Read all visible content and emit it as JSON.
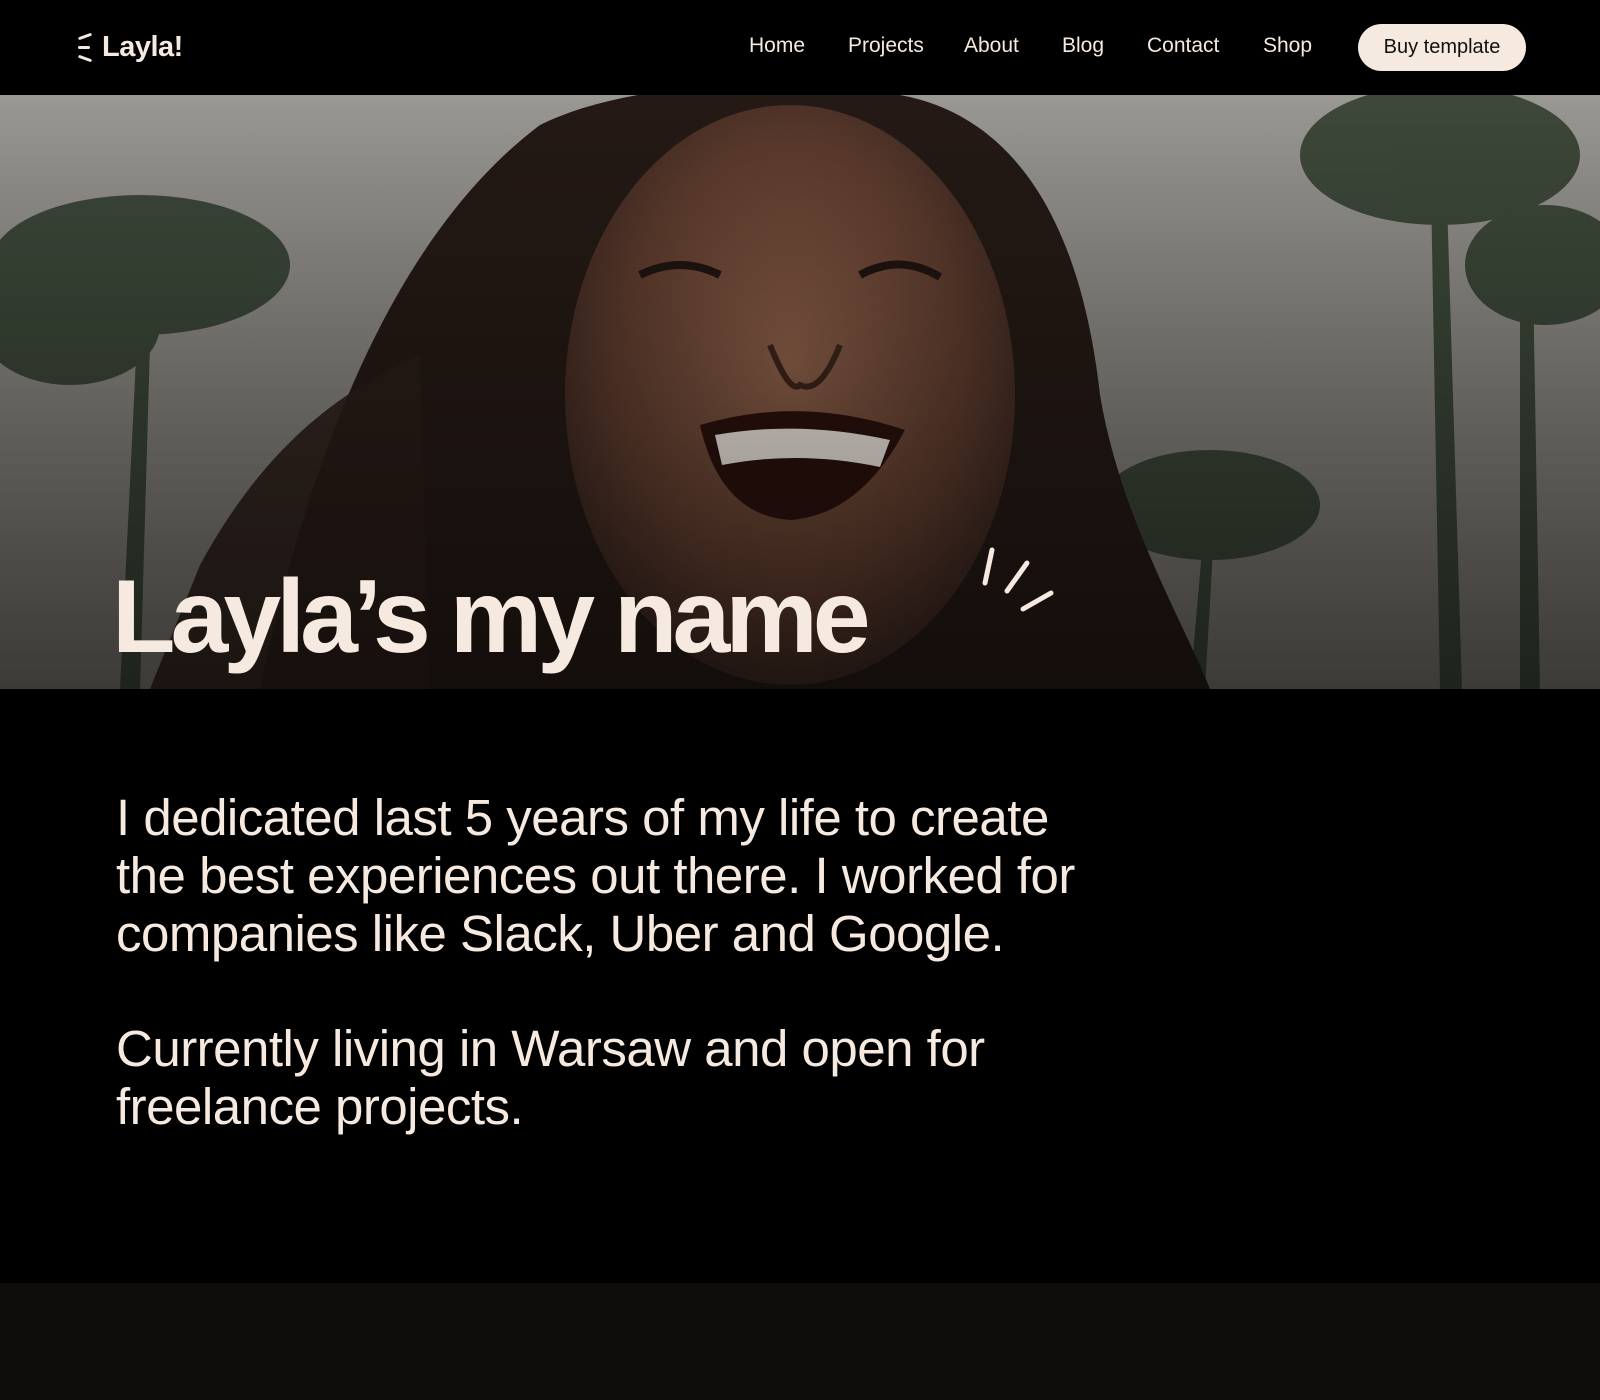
{
  "brand": {
    "name": "Layla!"
  },
  "nav": {
    "items": [
      {
        "label": "Home"
      },
      {
        "label": "Projects"
      },
      {
        "label": "About"
      },
      {
        "label": "Blog"
      },
      {
        "label": "Contact"
      },
      {
        "label": "Shop"
      }
    ],
    "cta_label": "Buy template"
  },
  "hero": {
    "title_words": [
      "Layla’s",
      "my",
      "name"
    ],
    "image": "smiling-woman-with-palm-trees-photo"
  },
  "about": {
    "paragraph_1": "I dedicated last 5 years of my life to create the best experiences out there. I worked for companies like Slack, Uber and Google.",
    "paragraph_2": "Currently living in Warsaw and open for freelance projects."
  },
  "colors": {
    "background": "#000000",
    "text": "#f5e9e0",
    "button_bg": "#f5e9e0",
    "button_text": "#111111",
    "footer_band": "#0f0d0b"
  },
  "icons": {
    "logo": "logo-dash-icon",
    "hero_accent": "sparkle-lines-icon"
  }
}
